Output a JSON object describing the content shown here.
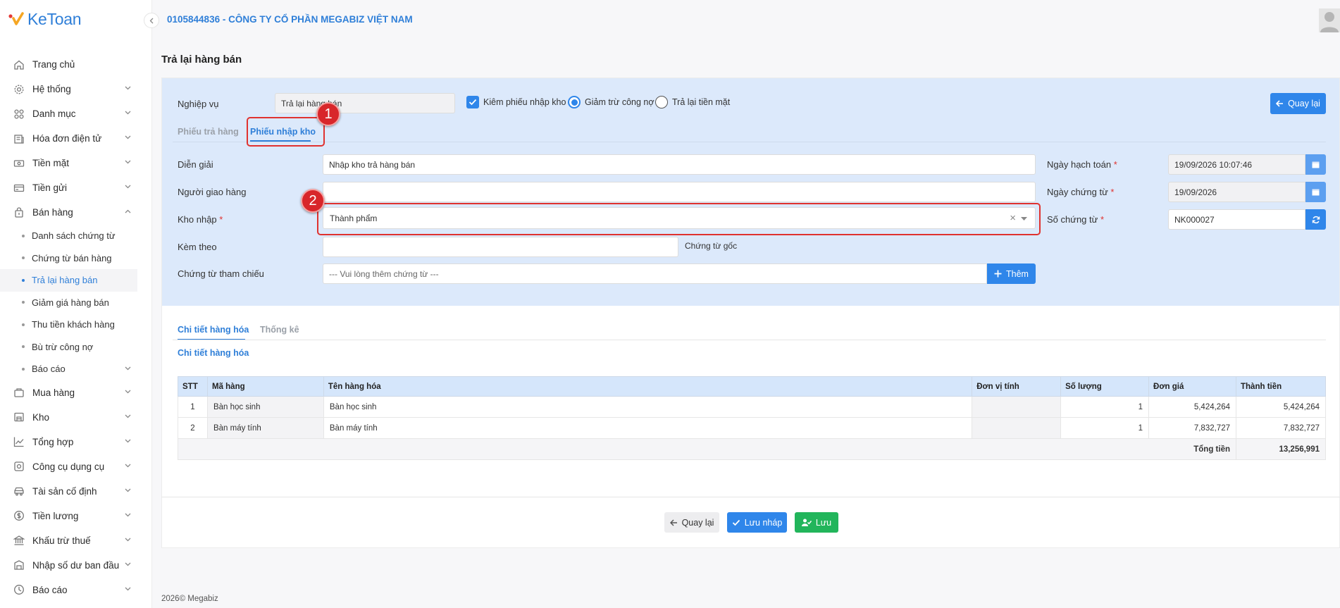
{
  "app": {
    "logo_text": "KeToan",
    "company": "0105844836 - CÔNG TY CỔ PHẦN MEGABIZ VIỆT NAM",
    "page_title": "Trả lại hàng bán",
    "footer": "2026© Megabiz"
  },
  "sidebar": {
    "items": [
      {
        "label": "Trang chủ",
        "icon": "home-icon"
      },
      {
        "label": "Hệ thống",
        "icon": "gear-icon"
      },
      {
        "label": "Danh mục",
        "icon": "grid-icon"
      },
      {
        "label": "Hóa đơn điện tử",
        "icon": "invoice-icon"
      },
      {
        "label": "Tiền mặt",
        "icon": "cash-icon"
      },
      {
        "label": "Tiền gửi",
        "icon": "card-icon"
      },
      {
        "label": "Bán hàng",
        "icon": "bag-icon"
      }
    ],
    "sub_items": [
      "Danh sách chứng từ",
      "Chứng từ bán hàng",
      "Trả lại hàng bán",
      "Giảm giá hàng bán",
      "Thu tiền khách hàng",
      "Bù trừ công nợ",
      "Báo cáo"
    ],
    "items_after": [
      {
        "label": "Mua hàng",
        "icon": "cart-icon"
      },
      {
        "label": "Kho",
        "icon": "warehouse-icon"
      },
      {
        "label": "Tổng hợp",
        "icon": "chart-icon"
      },
      {
        "label": "Công cụ dụng cụ",
        "icon": "tools-icon"
      },
      {
        "label": "Tài sản cố định",
        "icon": "car-icon"
      },
      {
        "label": "Tiền lương",
        "icon": "salary-icon"
      },
      {
        "label": "Khấu trừ thuế",
        "icon": "bank-icon"
      },
      {
        "label": "Nhập số dư ban đầu",
        "icon": "balance-icon"
      },
      {
        "label": "Báo cáo",
        "icon": "report-icon"
      }
    ]
  },
  "form": {
    "nghiep_vu_label": "Nghiệp vụ",
    "nghiep_vu_value": "Trả lại hàng bán",
    "opt_kiem_phieu": "Kiêm phiếu nhập kho",
    "opt_giam_tru": "Giảm trừ công nợ",
    "opt_tra_lai": "Trả lại tiền mặt",
    "quay_lai_top": "Quay lại",
    "tab_phieu_tra": "Phiếu trả hàng",
    "tab_phieu_nhap": "Phiếu nhập kho",
    "dien_giai_label": "Diễn giải",
    "dien_giai_value": "Nhập kho trả hàng bán",
    "nguoi_giao_label": "Người giao hàng",
    "kho_nhap_label": "Kho nhập",
    "kho_nhap_value": "Thành phẩm",
    "kem_theo_label": "Kèm theo",
    "chung_tu_goc": "Chứng từ gốc",
    "tham_chieu_label": "Chứng từ tham chiếu",
    "tham_chieu_placeholder": "--- Vui lòng thêm chứng từ ---",
    "them_label": "Thêm",
    "ngay_hach_toan_label": "Ngày hạch toán",
    "ngay_hach_toan_value": "19/09/2026 10:07:46",
    "ngay_chung_tu_label": "Ngày chứng từ",
    "ngay_chung_tu_value": "19/09/2026",
    "so_chung_tu_label": "Số chứng từ",
    "so_chung_tu_value": "NK000027",
    "required_mark": "*",
    "clear_x": "×"
  },
  "annotations": {
    "badge1": "1",
    "badge2": "2"
  },
  "detail": {
    "tab_chi_tiet": "Chi tiết hàng hóa",
    "tab_thong_ke": "Thống kê",
    "sub_title": "Chi tiết hàng hóa",
    "columns": [
      "STT",
      "Mã hàng",
      "Tên hàng hóa",
      "Đơn vị tính",
      "Số lượng",
      "Đơn giá",
      "Thành tiền"
    ],
    "rows": [
      {
        "stt": "1",
        "ma": "Bàn học sinh",
        "ten": "Bàn học sinh",
        "dvt": "",
        "sl": "1",
        "dg": "5,424,264",
        "tt": "5,424,264"
      },
      {
        "stt": "2",
        "ma": "Bàn máy tính",
        "ten": "Bàn máy tính",
        "dvt": "",
        "sl": "1",
        "dg": "7,832,727",
        "tt": "7,832,727"
      }
    ],
    "total_label": "Tổng tiền",
    "total_value": "13,256,991"
  },
  "actions": {
    "back": "Quay lại",
    "draft": "Lưu nháp",
    "save": "Lưu"
  },
  "colors": {
    "primary": "#2f86ea",
    "accent_text": "#2f7fd8",
    "success": "#22b55b",
    "highlight": "#e0322f",
    "panel_bg": "#dce9fb"
  }
}
